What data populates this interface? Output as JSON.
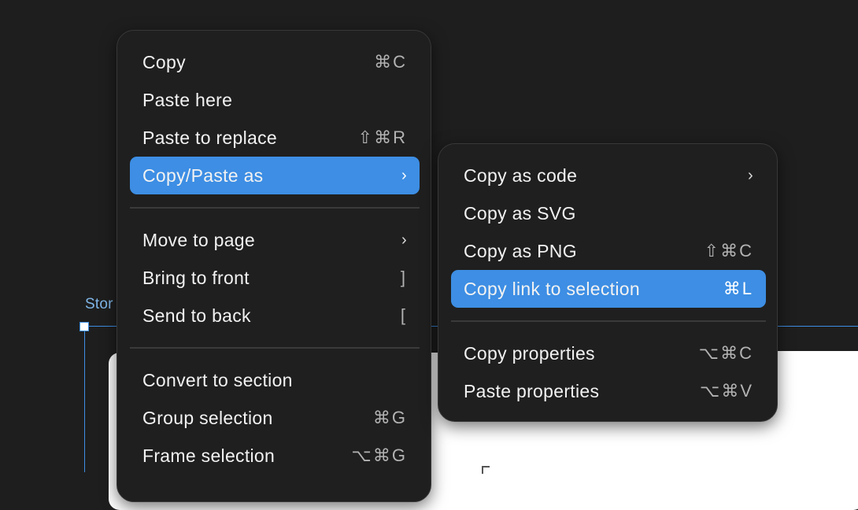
{
  "canvas": {
    "frame_label": "Stor"
  },
  "main_menu": {
    "groups": [
      [
        {
          "label": "Copy",
          "shortcut": "⌘C"
        },
        {
          "label": "Paste here",
          "shortcut": ""
        },
        {
          "label": "Paste to replace",
          "shortcut": "⇧⌘R"
        },
        {
          "label": "Copy/Paste as",
          "submenu": "›",
          "highlighted": true
        }
      ],
      [
        {
          "label": "Move to page",
          "submenu": "›"
        },
        {
          "label": "Bring to front",
          "shortcut": "]"
        },
        {
          "label": "Send to back",
          "shortcut": "["
        }
      ],
      [
        {
          "label": "Convert to section",
          "shortcut": ""
        },
        {
          "label": "Group selection",
          "shortcut": "⌘G"
        },
        {
          "label": "Frame selection",
          "shortcut": "⌥⌘G"
        }
      ]
    ]
  },
  "sub_menu": {
    "groups": [
      [
        {
          "label": "Copy as code",
          "submenu": "›"
        },
        {
          "label": "Copy as SVG",
          "shortcut": ""
        },
        {
          "label": "Copy as PNG",
          "shortcut": "⇧⌘C"
        },
        {
          "label": "Copy link to selection",
          "shortcut": "⌘L",
          "highlighted": true
        }
      ],
      [
        {
          "label": "Copy properties",
          "shortcut": "⌥⌘C"
        },
        {
          "label": "Paste properties",
          "shortcut": "⌥⌘V"
        }
      ]
    ]
  },
  "colors": {
    "background": "#1e1e1e",
    "menu": "#1f1f1f",
    "highlight": "#3d8ee4",
    "selection": "#3d8ee4"
  }
}
